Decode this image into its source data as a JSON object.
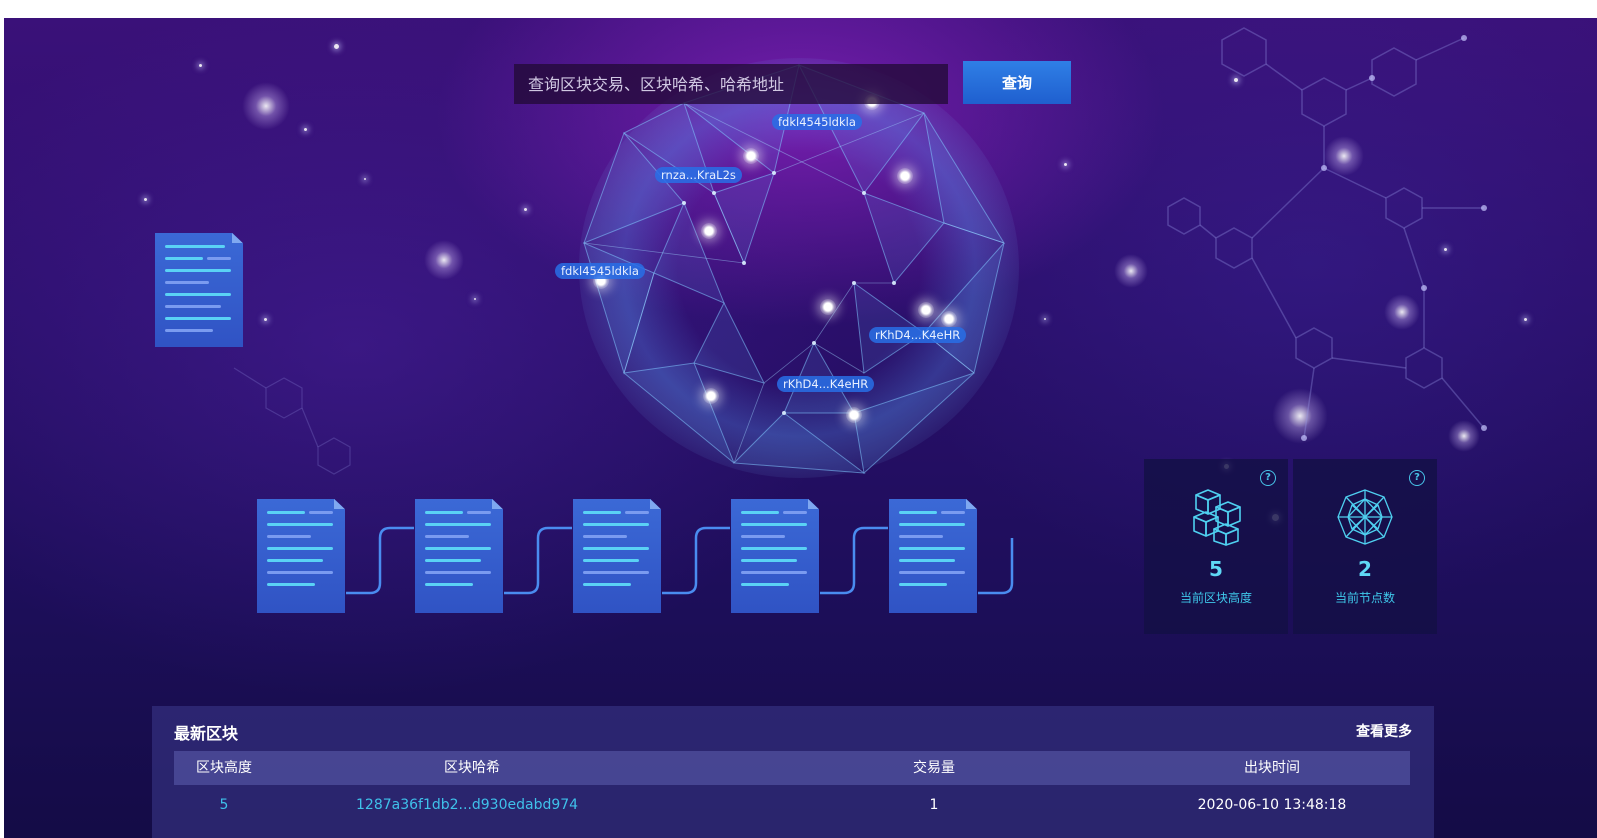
{
  "search": {
    "placeholder": "查询区块交易、区块哈希、哈希地址",
    "button_label": "查询"
  },
  "network_nodes": [
    {
      "label": "fdkl4545ldkla"
    },
    {
      "label": "rnza...KraL2s"
    },
    {
      "label": "fdkl4545ldkla"
    },
    {
      "label": "rKhD4...K4eHR"
    },
    {
      "label": "rKhD4...K4eHR"
    }
  ],
  "stats": [
    {
      "value": "5",
      "label": "当前区块高度",
      "icon": "cubes-icon",
      "help_icon": "question-circle-icon"
    },
    {
      "value": "2",
      "label": "当前节点数",
      "icon": "globe-network-icon",
      "help_icon": "question-circle-icon"
    }
  ],
  "latest_blocks": {
    "title": "最新区块",
    "more_label": "查看更多",
    "columns": [
      "区块高度",
      "区块哈希",
      "交易量",
      "出块时间"
    ],
    "rows": [
      {
        "height": "5",
        "hash": "1287a36f1db2...d930edabd974",
        "tx_count": "1",
        "time": "2020-06-10 13:48:18"
      }
    ]
  },
  "colors": {
    "background_top": "#3a1179",
    "background_bottom": "#140c46",
    "accent_blue": "#2f7fe6",
    "stat_text": "#5fd8f5",
    "link_text": "#3fc1ea"
  }
}
